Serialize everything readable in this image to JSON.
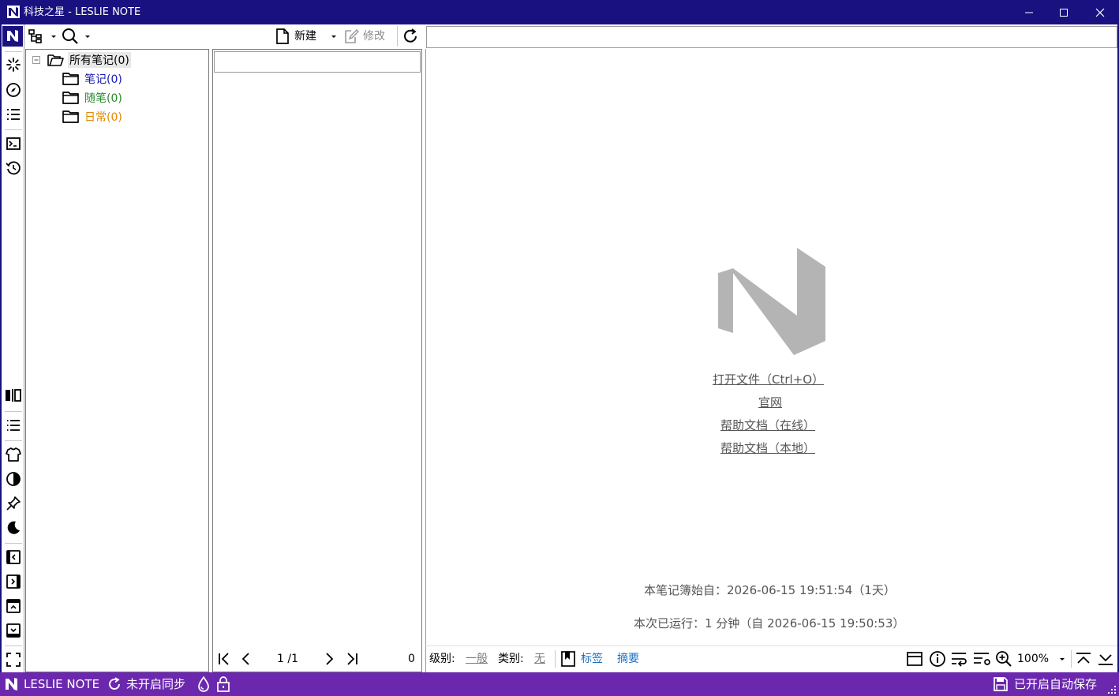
{
  "window": {
    "title": "科技之星 - LESLIE NOTE",
    "minimize_icon": "minimize-icon",
    "maximize_icon": "maximize-icon",
    "close_icon": "close-icon"
  },
  "toolbar": {
    "new_label": "新建",
    "edit_label": "修改"
  },
  "tree": {
    "root": {
      "label": "所有笔记(0)"
    },
    "children": [
      {
        "label": "笔记(0)",
        "color": "#1a1ab4"
      },
      {
        "label": "随笔(0)",
        "color": "#2a8a2a"
      },
      {
        "label": "日常(0)",
        "color": "#e08a00"
      }
    ]
  },
  "list": {
    "page": "1 /1",
    "count": "0"
  },
  "welcome": {
    "open_file": "打开文件（Ctrl+O）",
    "website": "官网",
    "help_online": "帮助文档（在线）",
    "help_local": "帮助文档（本地）",
    "started": "本笔记簿始自：2026-06-15 19:51:54（1天）",
    "running": "本次已运行：1 分钟（自 2026-06-15 19:50:53）"
  },
  "editor_bar": {
    "level_label": "级别:",
    "level_value": "一般",
    "category_label": "类别:",
    "category_value": "无",
    "tags_label": "标签",
    "summary_label": "摘要",
    "zoom": "100%"
  },
  "status": {
    "app_name": "LESLIE NOTE",
    "sync": "未开启同步",
    "autosave": "已开启自动保存"
  },
  "colors": {
    "titlebar": "#1a1180",
    "statusbar": "#6b28ae",
    "link_blue": "#1a6fc0"
  }
}
